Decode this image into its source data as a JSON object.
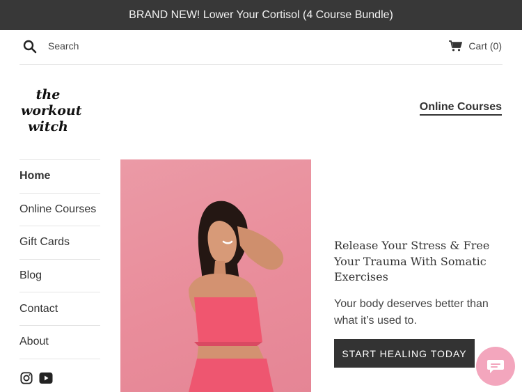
{
  "announcement": {
    "text": "BRAND NEW! Lower Your Cortisol (4 Course Bundle)"
  },
  "header": {
    "search_label": "Search",
    "search_icon": "search-icon",
    "cart_label": "Cart",
    "cart_count": "(0)",
    "cart_icon": "cart-icon",
    "logo_lines": [
      "the",
      "workout",
      "witch"
    ],
    "top_nav_link": "Online Courses"
  },
  "sidebar": {
    "items": [
      {
        "label": "Home",
        "active": true
      },
      {
        "label": "Online Courses",
        "active": false
      },
      {
        "label": "Gift Cards",
        "active": false
      },
      {
        "label": "Blog",
        "active": false
      },
      {
        "label": "Contact",
        "active": false
      },
      {
        "label": "About",
        "active": false
      }
    ],
    "social_icons": [
      "instagram-icon",
      "youtube-icon"
    ]
  },
  "promo": {
    "title": "Release Your Stress & Free Your Trauma With Somatic Exercises",
    "body": "Your body deserves better than what it’s used to.",
    "cta_label": "START HEALING TODAY"
  },
  "chat": {
    "icon": "chat-icon"
  },
  "colors": {
    "announcement_bg": "#383838",
    "hero_bg": "#eb9aa6",
    "top_color": "#f0566f",
    "button_bg": "#333333",
    "chat_bg": "#f3a6bd"
  }
}
